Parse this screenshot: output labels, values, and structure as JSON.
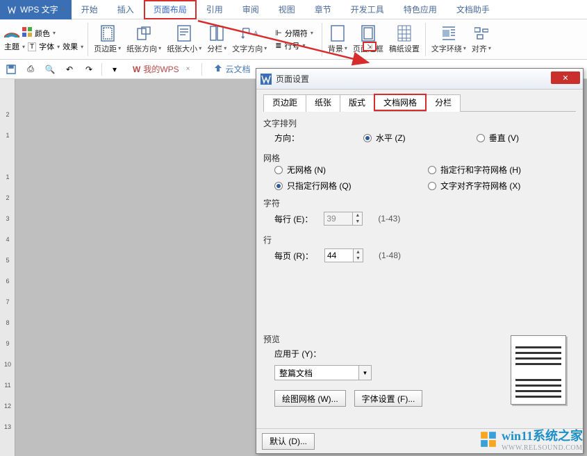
{
  "app": {
    "brand": "WPS 文字"
  },
  "menu": [
    "开始",
    "插入",
    "页面布局",
    "引用",
    "审阅",
    "视图",
    "章节",
    "开发工具",
    "特色应用",
    "文档助手"
  ],
  "ribbon": {
    "color": "颜色",
    "theme": "主题",
    "font": "字体",
    "effect": "效果",
    "page_margin": "页边距",
    "paper_orient": "纸张方向",
    "paper_size": "纸张大小",
    "columns": "分栏",
    "text_dir": "文字方向",
    "line_num": "行号",
    "separator": "分隔符",
    "background": "背景",
    "page_border": "页面边框",
    "manuscript": "稿纸设置",
    "text_wrap": "文字环绕",
    "align": "对齐"
  },
  "qat": {
    "mywps": "我的WPS",
    "cloud": "云文档"
  },
  "dialog": {
    "title": "页面设置",
    "tabs": [
      "页边距",
      "纸张",
      "版式",
      "文档网格",
      "分栏"
    ],
    "g_text_arrange": "文字排列",
    "dir_label": "方向：",
    "dir_h": "水平 (Z)",
    "dir_v": "垂直 (V)",
    "g_grid": "网格",
    "grid_none": "无网格 (N)",
    "grid_rowchar": "指定行和字符网格 (H)",
    "grid_rowonly": "只指定行网格 (Q)",
    "grid_align": "文字对齐字符网格 (X)",
    "g_char": "字符",
    "per_line_label": "每行 (E)：",
    "per_line_val": "39",
    "per_line_range": "(1-43)",
    "g_line": "行",
    "per_page_label": "每页 (R)：",
    "per_page_val": "44",
    "per_page_range": "(1-48)",
    "g_preview": "预览",
    "apply_label": "应用于 (Y)：",
    "apply_val": "整篇文档",
    "btn_drawgrid": "绘图网格 (W)...",
    "btn_fontset": "字体设置 (F)...",
    "btn_default": "默认 (D)..."
  },
  "watermark": {
    "main": "win11系统之家",
    "sub": "WWW.RELSOUND.COM"
  }
}
